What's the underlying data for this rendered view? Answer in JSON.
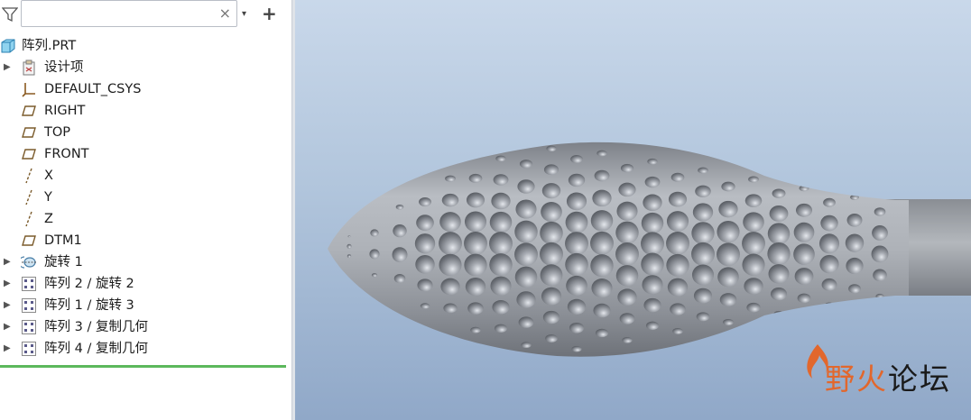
{
  "search": {
    "placeholder": "",
    "value": "",
    "clear_label": "×"
  },
  "toolbar": {
    "dropdown_label": "▾",
    "add_label": "+"
  },
  "tree": {
    "root": "阵列.PRT",
    "items": [
      {
        "label": "设计项",
        "icon": "design-items-icon",
        "expandable": true
      },
      {
        "label": "DEFAULT_CSYS",
        "icon": "csys-icon",
        "expandable": false
      },
      {
        "label": "RIGHT",
        "icon": "datum-plane-icon",
        "expandable": false
      },
      {
        "label": "TOP",
        "icon": "datum-plane-icon",
        "expandable": false
      },
      {
        "label": "FRONT",
        "icon": "datum-plane-icon",
        "expandable": false
      },
      {
        "label": "X",
        "icon": "datum-axis-icon",
        "expandable": false
      },
      {
        "label": "Y",
        "icon": "datum-axis-icon",
        "expandable": false
      },
      {
        "label": "Z",
        "icon": "datum-axis-icon",
        "expandable": false
      },
      {
        "label": "DTM1",
        "icon": "datum-plane-icon",
        "expandable": false
      },
      {
        "label": "旋转 1",
        "icon": "revolve-icon",
        "expandable": true
      },
      {
        "label": "阵列 2 / 旋转 2",
        "icon": "pattern-icon",
        "expandable": true
      },
      {
        "label": "阵列 1 / 旋转 3",
        "icon": "pattern-icon",
        "expandable": true
      },
      {
        "label": "阵列 3 / 复制几何",
        "icon": "pattern-icon",
        "expandable": true
      },
      {
        "label": "阵列 4 / 复制几何",
        "icon": "pattern-icon",
        "expandable": true
      }
    ]
  },
  "watermark": {
    "part1": "野火",
    "part2": "论坛"
  },
  "colors": {
    "accent_insert": "#5cb85c",
    "plane_icon": "#7a5a2a",
    "model": "#a9adb3"
  }
}
